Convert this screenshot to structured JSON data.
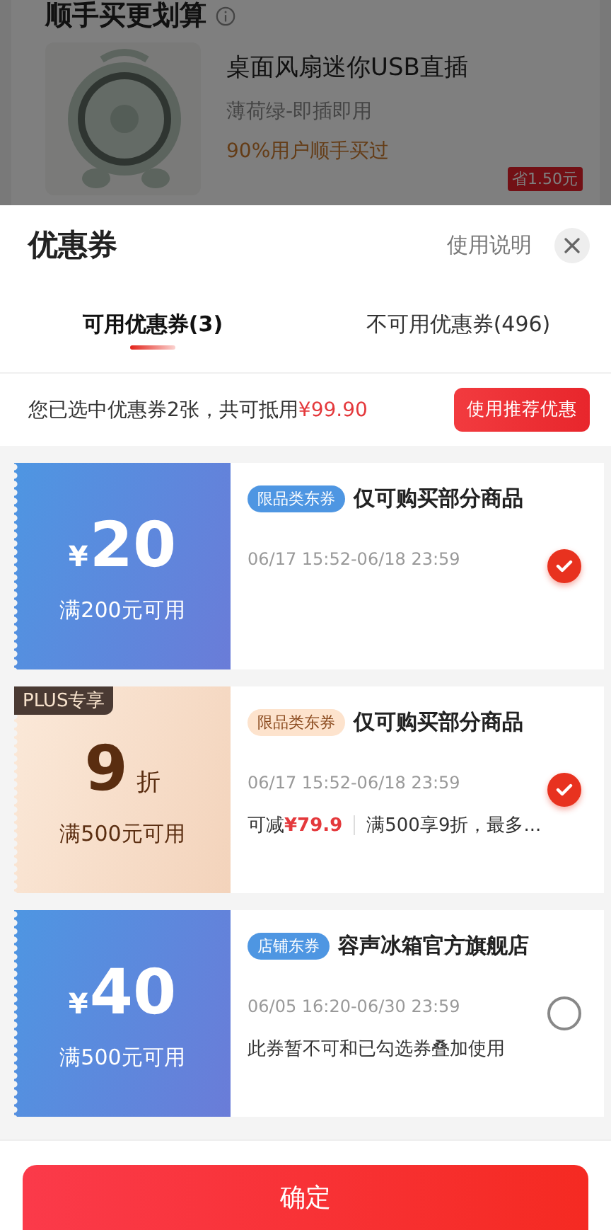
{
  "background": {
    "section_title": "顺手买更划算",
    "product": {
      "name": "桌面风扇迷你USB直插",
      "variant": "薄荷绿-即插即用",
      "social_proof": "90%用户顺手买过",
      "saving_tag": "省1.50元"
    }
  },
  "sheet": {
    "title": "优惠券",
    "help_link": "使用说明"
  },
  "tabs": [
    {
      "label": "可用优惠券(3)",
      "selected": true
    },
    {
      "label": "不可用优惠券(496)",
      "selected": false
    }
  ],
  "summary": {
    "text": "您已选中优惠券2张，共可抵用",
    "amount": "¥99.90",
    "button": "使用推荐优惠"
  },
  "coupons": [
    {
      "kind": "amount",
      "currency": "¥",
      "value": "20",
      "condition": "满200元可用",
      "badge": "限品类东券",
      "title": "仅可购买部分商品",
      "validity": "06/17 15:52-06/18 23:59",
      "selected": true
    },
    {
      "kind": "discount",
      "plus_label": "PLUS专享",
      "value": "9",
      "unit": "折",
      "condition": "满500元可用",
      "badge": "限品类东券",
      "title": "仅可购买部分商品",
      "validity": "06/17 15:52-06/18 23:59",
      "saving_label": "可减",
      "saving": "¥79.9",
      "detail": "满500享9折，最多...",
      "selected": true
    },
    {
      "kind": "amount",
      "currency": "¥",
      "value": "40",
      "condition": "满500元可用",
      "badge": "店铺东券",
      "title": "容声冰箱官方旗舰店",
      "validity": "06/05 16:20-06/30 23:59",
      "note": "此券暂不可和已勾选券叠加使用",
      "selected": false
    }
  ],
  "confirm_button": "确定"
}
